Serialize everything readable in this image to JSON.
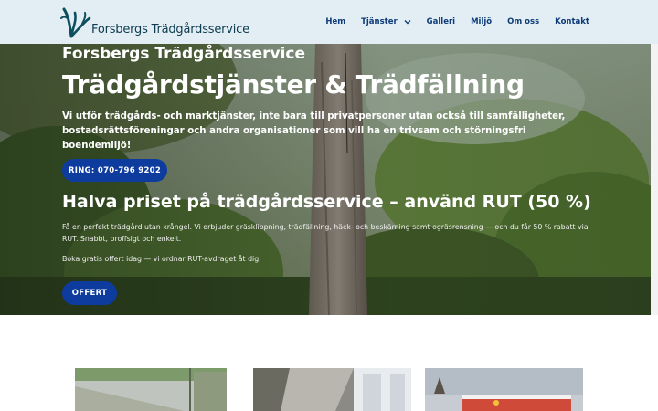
{
  "header": {
    "logo_text": "Forsbergs Trädgårdsservice",
    "nav": [
      {
        "label": "Hem"
      },
      {
        "label": "Tjänster",
        "has_dropdown": true
      },
      {
        "label": "Galleri"
      },
      {
        "label": "Miljö"
      },
      {
        "label": "Om oss"
      },
      {
        "label": "Kontakt"
      }
    ]
  },
  "hero": {
    "brand": "Forsbergs Trädgårdsservice",
    "title": "Trädgårdstjänster & Trädfällning",
    "subtitle": "Vi utför trädgårds- och marktjänster, inte bara till privatpersoner utan också till samfälligheter, bostadsrättsföreningar och andra organisationer som vill ha en trivsam och störningsfri boendemiljö!",
    "call_button": "RING: 070-796 9202",
    "rut_heading": "Halva priset på trädgårdsservice – använd RUT (50 %)",
    "rut_text": "Få en perfekt trädgård utan krångel. Vi erbjuder gräsklippning, trädfällning, häck- och beskärning samt ogräsrensning — och du får 50 % rabatt via RUT. Snabbt, proffsigt och enkelt.",
    "rut_text2": "Boka gratis offert idag — vi ordnar RUT-avdraget åt dig.",
    "offer_button": "OFFERT"
  },
  "colors": {
    "header_bg": "#e3eef4",
    "nav_text": "#0d3b78",
    "button_bg": "#0d3b9e",
    "logo_text": "#0d3b4f"
  },
  "icons": {
    "logo": "tree-logo-icon",
    "dropdown": "chevron-down-icon"
  }
}
